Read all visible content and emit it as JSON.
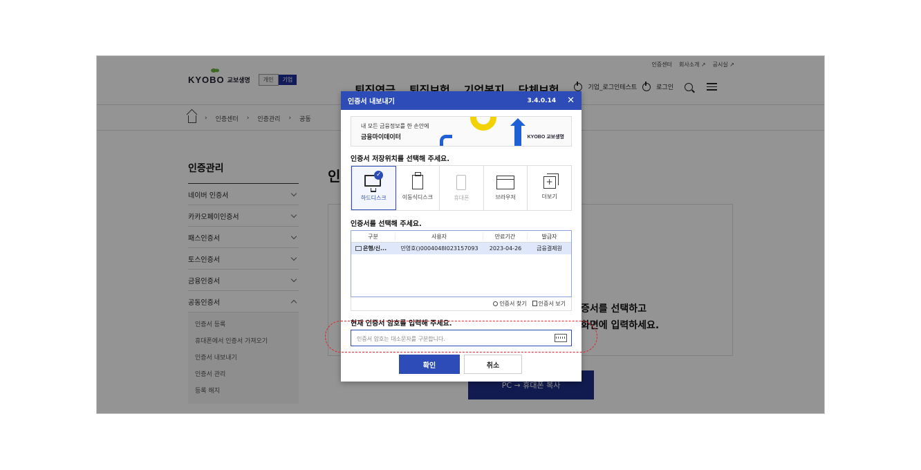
{
  "header": {
    "util_links": [
      "인증센터",
      "회사소개 ↗",
      "공시실 ↗"
    ],
    "logo_text": "KYOBO",
    "logo_kor": "교보생명",
    "chip_personal": "개인",
    "chip_corporate": "기업",
    "gnb": [
      "퇴직연금",
      "퇴직보험",
      "기업복지",
      "단체보험"
    ],
    "user_label": "기업_로그인테스트",
    "login_label": "로그인"
  },
  "breadcrumb": [
    "인증센터",
    "인증관리",
    "공동"
  ],
  "sidebar": {
    "title": "인증관리",
    "items": [
      {
        "label": "네이버 인증서"
      },
      {
        "label": "카카오페이인증서"
      },
      {
        "label": "패스인증서"
      },
      {
        "label": "토스인증서"
      },
      {
        "label": "금융인증서"
      },
      {
        "label": "공동인증서"
      }
    ],
    "sub_items": [
      "인증서 등록",
      "휴대폰에서 인증서 가져오기",
      "인증서 내보내기",
      "인증서 관리",
      "등록 해지"
    ]
  },
  "main": {
    "title_partial": "인",
    "content_line1": "증서를 선택하고",
    "content_line2": "화면에 입력하세요.",
    "pc_button": "PC → 휴대폰 복사"
  },
  "dialog": {
    "title": "인증서 내보내기",
    "version": "3.4.0.14",
    "close": "✕",
    "banner_line1": "내 모든 금융정보를 한 손안에",
    "banner_line2": "금융마이데이터",
    "banner_logo": "KYOBO 교보생명",
    "location_title": "인증서 저장위치를 선택해 주세요.",
    "locations": [
      "하드디스크",
      "이동식디스크",
      "휴대폰",
      "브라우저",
      "더보기"
    ],
    "select_title": "인증서를 선택해 주세요.",
    "columns": [
      "구분",
      "사용자",
      "만료기간",
      "발급자"
    ],
    "rows": [
      {
        "type": "은행/신...",
        "user": "민영호()0004048I023157093",
        "expire": "2023-04-26",
        "issuer": "금융결제원"
      }
    ],
    "find_label": "인증서 찾기",
    "view_label": "인증서 보기",
    "password_title": "현재 인증서 암호를 입력해 주세요.",
    "password_placeholder": "인증서 암호는 대소문자를 구분합니다.",
    "ok_label": "확인",
    "cancel_label": "취소"
  },
  "colors": {
    "dialog_blue": "#2d4cb8",
    "highlight_red": "#e0202a",
    "navy_button": "#1f2f8a"
  }
}
